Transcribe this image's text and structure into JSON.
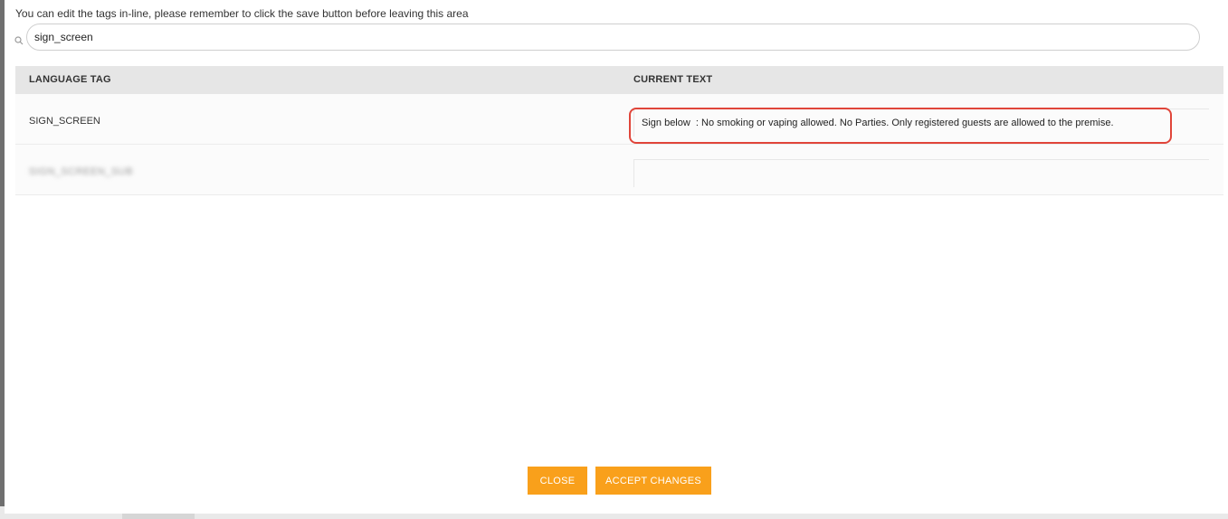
{
  "instruction": "You can edit the tags in-line, please remember to click the save button before leaving this area",
  "search": {
    "value": "sign_screen",
    "icon": "search-icon"
  },
  "table": {
    "headers": [
      "LANGUAGE TAG",
      "CURRENT TEXT"
    ],
    "rows": [
      {
        "tag": "SIGN_SCREEN",
        "text": "Sign below  : No smoking or vaping allowed. No Parties. Only registered guests are allowed to the premise."
      },
      {
        "tag": "SIGN_SCREEN_SUB",
        "text": ""
      }
    ]
  },
  "buttons": {
    "close": "CLOSE",
    "accept": "ACCEPT CHANGES"
  },
  "colors": {
    "accent": "#f9a01b",
    "highlight": "#e0453a",
    "header_bg": "#e6e6e6"
  }
}
